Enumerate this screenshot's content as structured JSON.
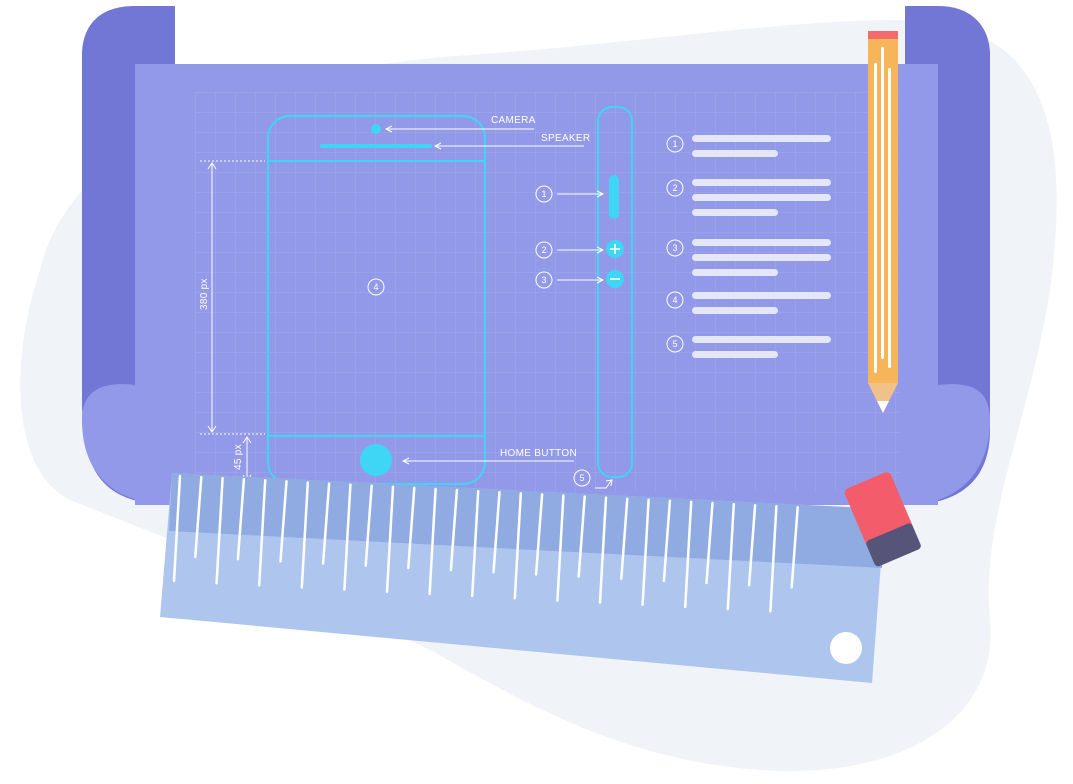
{
  "annotations": {
    "camera": "CAMERA",
    "speaker": "SPEAKER",
    "home_button": "HOME BUTTON",
    "height_screen": "380 px",
    "height_bottom": "45 px"
  },
  "markers": {
    "screen": "4",
    "side_button": "1",
    "volume_up": "2",
    "volume_down": "3",
    "side_frame": "5"
  },
  "legend": {
    "items": [
      {
        "number": "1"
      },
      {
        "number": "2"
      },
      {
        "number": "3"
      },
      {
        "number": "4"
      },
      {
        "number": "5"
      }
    ]
  },
  "colors": {
    "background_blob": "#f0f3f7",
    "paper": "#9299e8",
    "paper_roll": "#7276d4",
    "blueprint_lines": "#3fd6f5",
    "ruler": "#aec6ee",
    "pencil": "#f7b55a",
    "eraser": "#f35d6b"
  }
}
